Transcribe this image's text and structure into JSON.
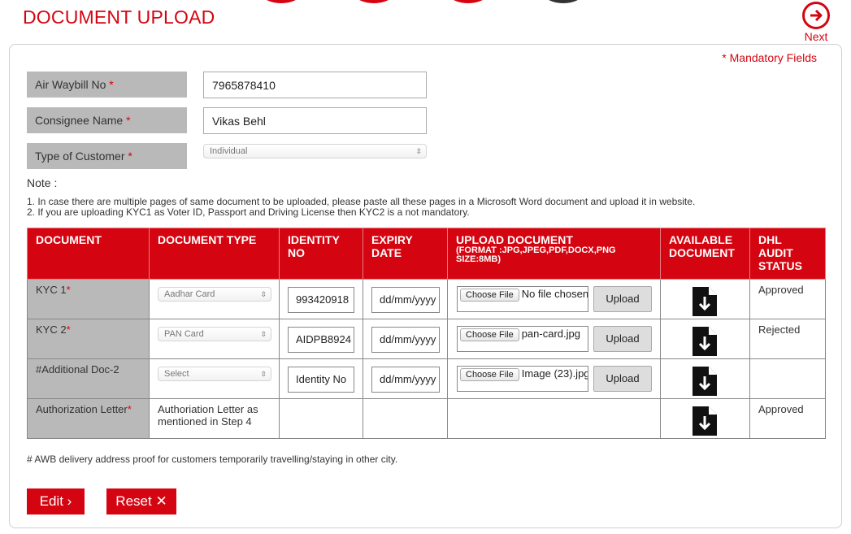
{
  "page": {
    "title": "DOCUMENT UPLOAD",
    "next_label": "Next"
  },
  "mandatory_note": "* Mandatory Fields",
  "form": {
    "awb_label": "Air Waybill No",
    "awb_value": "7965878410",
    "consignee_label": "Consignee Name",
    "consignee_value": "Vikas Behl",
    "customer_type_label": "Type of Customer",
    "customer_type_value": "Individual",
    "required_mark": "*"
  },
  "notes": {
    "title": "Note :",
    "line1": "1. In case there are multiple pages of same document to be uploaded, please paste all these pages in a Microsoft Word document and upload it in website.",
    "line2": "2. If you are uploading KYC1 as Voter ID, Passport and Driving License then KYC2 is a not mandatory."
  },
  "table": {
    "headers": {
      "document": "DOCUMENT",
      "document_type": "DOCUMENT TYPE",
      "identity_no": "IDENTITY NO",
      "expiry_date": "EXPIRY DATE",
      "upload_document": "UPLOAD DOCUMENT",
      "upload_format": "(FORMAT :JPG,JPEG,PDF,DOCX,PNG SIZE:8MB)",
      "available_document": "AVAILABLE DOCUMENT",
      "dhl_audit_status": "DHL AUDIT STATUS"
    },
    "choose_file_label": "Choose File",
    "upload_label": "Upload",
    "date_placeholder": "dd/mm/yyyy",
    "rows": [
      {
        "document": "KYC 1",
        "required": "*",
        "doc_type": "Aadhar Card",
        "identity": "993420918",
        "file": "No file chosen",
        "status": "Approved"
      },
      {
        "document": "KYC 2",
        "required": "*",
        "doc_type": "PAN Card",
        "identity": "AIDPB8924",
        "file": "pan-card.jpg",
        "status": "Rejected"
      },
      {
        "document": "#Additional Doc-2",
        "required": "",
        "doc_type": "Select",
        "identity": "Identity No",
        "file": "Image (23).jpg",
        "status": ""
      },
      {
        "document": "Authorization Letter",
        "required": "*",
        "doc_type_text": "Authoriation Letter as mentioned in Step 4",
        "status": "Approved"
      }
    ]
  },
  "footnote": "# AWB delivery address proof for customers temporarily travelling/staying in other city.",
  "actions": {
    "edit_label": "Edit",
    "reset_label": "Reset"
  },
  "colors": {
    "brand_red": "#d40511",
    "label_gray": "#b9b9b9"
  },
  "icons": {
    "next": "arrow-right-circle-icon",
    "download": "download-file-icon",
    "edit": "chevron-right-icon",
    "reset": "close-icon"
  }
}
